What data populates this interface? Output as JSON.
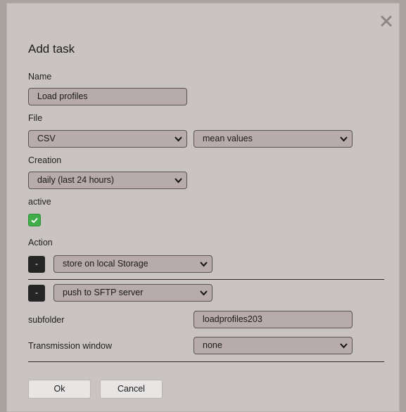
{
  "dialog": {
    "title": "Add task",
    "close_icon": "close-x-icon"
  },
  "form": {
    "name_label": "Name",
    "name_value": "Load profiles",
    "file_label": "File",
    "file_format": "CSV",
    "file_values": "mean values",
    "creation_label": "Creation",
    "creation_value": "daily (last 24 hours)",
    "active_label": "active",
    "active_checked": true,
    "action_label": "Action"
  },
  "actions": [
    {
      "remove_label": "-",
      "value": "store on local Storage"
    },
    {
      "remove_label": "-",
      "value": "push to SFTP server"
    }
  ],
  "sftp": {
    "subfolder_label": "subfolder",
    "subfolder_value": "loadprofiles203",
    "window_label": "Transmission window",
    "window_value": "none"
  },
  "buttons": {
    "ok": "Ok",
    "cancel": "Cancel"
  },
  "colors": {
    "dialog_bg": "#c9c4c1",
    "field_bg": "#b8abab",
    "checkbox_green": "#41ad4a",
    "dark_button": "#252525"
  }
}
